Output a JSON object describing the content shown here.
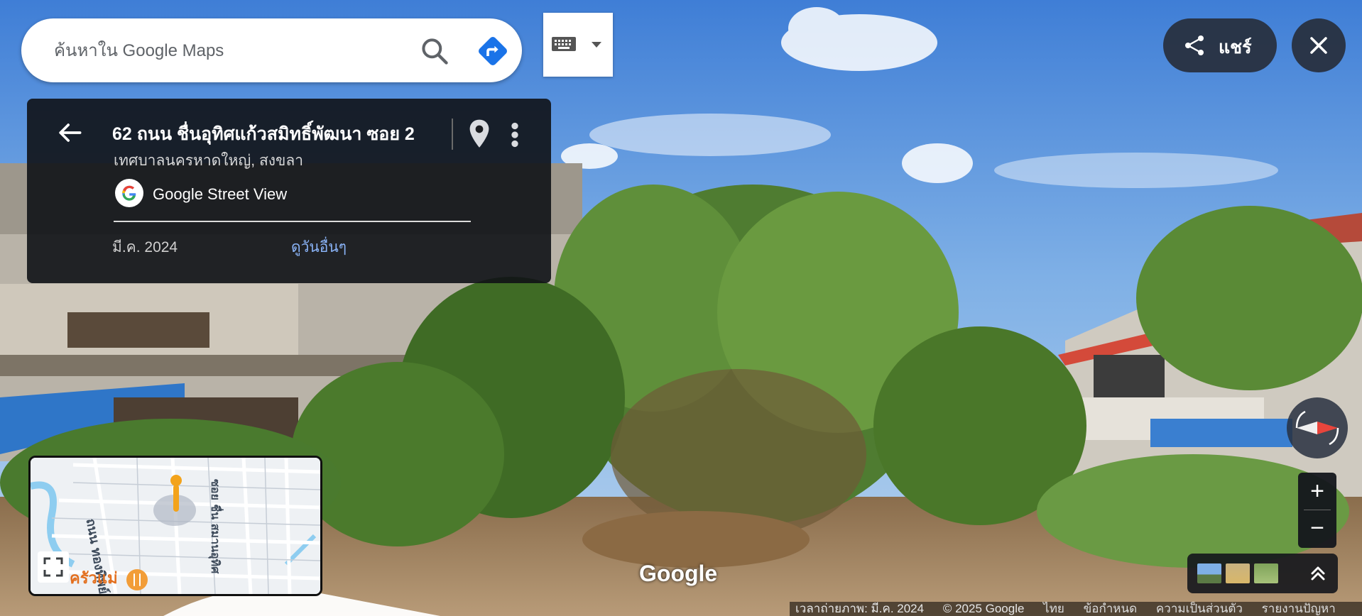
{
  "search": {
    "placeholder": "ค้นหาใน Google Maps"
  },
  "info_card": {
    "address": "62 ถนน ชื่นอุทิศแก้วสมิทธิ์พัฒนา ซอย 2",
    "locality": "เทศบาลนครหาดใหญ่, สงขลา",
    "source": "Google Street View",
    "capture_date": "มี.ค. 2024",
    "more_dates": "ดูวันอื่นๆ"
  },
  "share_label": "แชร์",
  "logo_text": "Google",
  "minimap": {
    "roads": [
      "ถนน ทองทิพย์",
      "ซอย ชื่น สมานอุทิศ"
    ],
    "poi": "ครัวแม่"
  },
  "footer": {
    "imagery_date": "เวลาถ่ายภาพ: มี.ค. 2024",
    "copyright": "© 2025 Google",
    "links": [
      "ไทย",
      "ข้อกำหนด",
      "ความเป็นส่วนตัว",
      "รายงานปัญหา"
    ]
  },
  "colors": {
    "accent": "#1a73e8",
    "panel": "#101216",
    "link": "#8ab4f8",
    "pegman": "#f3a31b"
  },
  "icons": [
    "search-icon",
    "directions-icon",
    "keyboard-icon",
    "back-arrow-icon",
    "pin-icon",
    "more-vert-icon",
    "google-g-icon",
    "share-icon",
    "close-icon",
    "compass-icon",
    "fullscreen-icon",
    "chevron-up-icon",
    "pegman-icon",
    "restaurant-icon"
  ]
}
